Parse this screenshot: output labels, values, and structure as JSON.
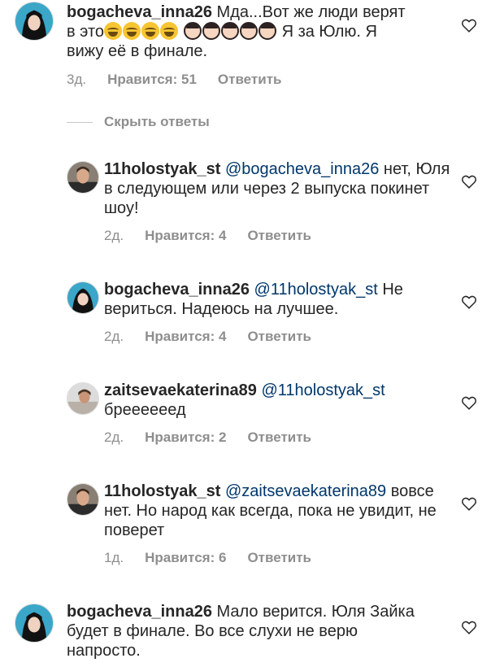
{
  "comments": [
    {
      "username": "bogacheva_inna26",
      "text_before": "Мда...Вот же люди верят в это",
      "text_after": " Я за Юлю. Я вижу её в финале.",
      "emojis": [
        "laugh",
        "laugh",
        "laugh",
        "laugh",
        "woman",
        "woman",
        "woman",
        "woman",
        "woman"
      ],
      "time": "3д.",
      "likes": "Нравится: 51",
      "reply": "Ответить"
    }
  ],
  "hide_replies": "Скрыть ответы",
  "replies": [
    {
      "username": "11holostyak_st",
      "mention": "@bogacheva_inna26",
      "text": " нет, Юля в следующем или через 2 выпуска покинет шоу!",
      "time": "2д.",
      "likes": "Нравится: 4",
      "reply": "Ответить"
    },
    {
      "username": "bogacheva_inna26",
      "mention": "@11holostyak_st",
      "text": " Не вериться. Надеюсь на лучшее.",
      "time": "2д.",
      "likes": "Нравится: 4",
      "reply": "Ответить"
    },
    {
      "username": "zaitsevaekaterina89",
      "mention": "@11holostyak_st",
      "text": " бреееееед",
      "time": "2д.",
      "likes": "Нравится: 2",
      "reply": "Ответить"
    },
    {
      "username": "11holostyak_st",
      "mention": "@zaitsevaekaterina89",
      "text": " вовсе нет. Но народ как всегда, пока не увидит, не поверет",
      "time": "1д.",
      "likes": "Нравится: 6",
      "reply": "Ответить"
    }
  ],
  "last_comment": {
    "username": "bogacheva_inna26",
    "text": " Мало верится. Юля Зайка будет в финале. Во все слухи не верю напросто."
  },
  "icons": {
    "like": "heart-outline-icon"
  },
  "colors": {
    "text": "#262626",
    "muted": "#8e8e8e",
    "mention": "#00376b"
  }
}
